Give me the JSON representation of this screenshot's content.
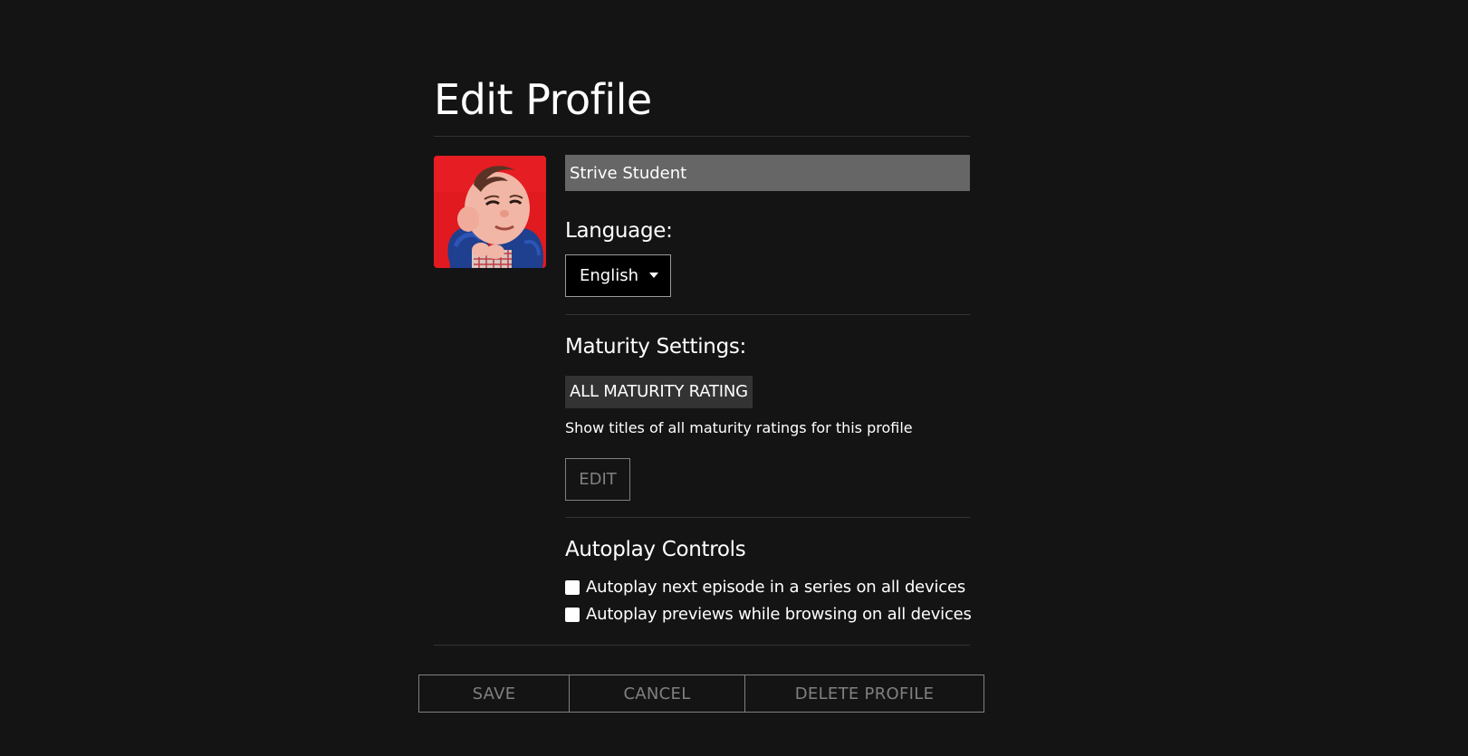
{
  "header": {
    "title": "Edit Profile"
  },
  "profile": {
    "avatar_icon": "profile-avatar-image",
    "name_value": "Strive Student"
  },
  "language": {
    "label": "Language:",
    "selected": "English"
  },
  "maturity": {
    "label": "Maturity Settings:",
    "rating": "ALL MATURITY RATING",
    "description": "Show titles of all maturity ratings for this profile",
    "edit_label": "EDIT"
  },
  "autoplay": {
    "label": "Autoplay Controls",
    "options": [
      {
        "label": "Autoplay next episode in a series on all devices",
        "checked": false
      },
      {
        "label": "Autoplay previews while browsing on all devices",
        "checked": false
      }
    ]
  },
  "actions": {
    "save": "SAVE",
    "cancel": "CANCEL",
    "delete": "DELETE PROFILE"
  },
  "colors": {
    "background": "#141414",
    "input_background": "#666666",
    "badge_background": "#333333",
    "muted_button": "#808080",
    "avatar_red": "#e3141c"
  }
}
